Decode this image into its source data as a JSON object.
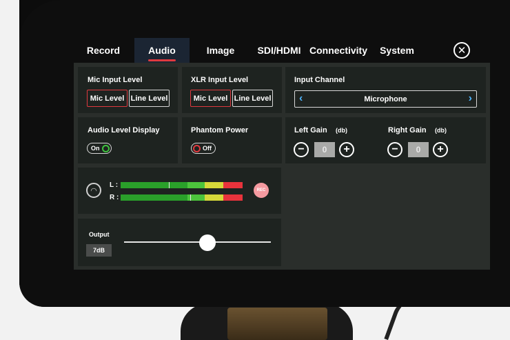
{
  "tabs": [
    {
      "label": "Record",
      "active": false
    },
    {
      "label": "Audio",
      "active": true
    },
    {
      "label": "Image",
      "active": false
    },
    {
      "label": "SDI/HDMI",
      "active": false
    },
    {
      "label": "Connectivity",
      "active": false
    },
    {
      "label": "System",
      "active": false
    }
  ],
  "close_icon": "close-icon",
  "mic_input": {
    "title": "Mic Input Level",
    "options": [
      "Mic Level",
      "Line Level"
    ],
    "selected": "Mic Level"
  },
  "xlr_input": {
    "title": "XLR Input Level",
    "options": [
      "Mic Level",
      "Line Level"
    ],
    "selected": "Mic Level"
  },
  "input_channel": {
    "title": "Input Channel",
    "value": "Microphone"
  },
  "audio_level_display": {
    "title": "Audio Level Display",
    "state": "On"
  },
  "phantom_power": {
    "title": "Phantom Power",
    "state": "Off"
  },
  "left_gain": {
    "title": "Left Gain",
    "unit": "(db)",
    "value": "0"
  },
  "right_gain": {
    "title": "Right Gain",
    "unit": "(db)",
    "value": "0"
  },
  "meters": {
    "left_label": "L :",
    "right_label": "R :",
    "rec_label": "REC"
  },
  "output": {
    "title": "Output",
    "value": "7dB",
    "level_fraction": 0.57
  },
  "colors": {
    "accent_red": "#e0393f",
    "selector_arrow": "#4fb6ff",
    "toggle_on": "#3ec23e"
  }
}
